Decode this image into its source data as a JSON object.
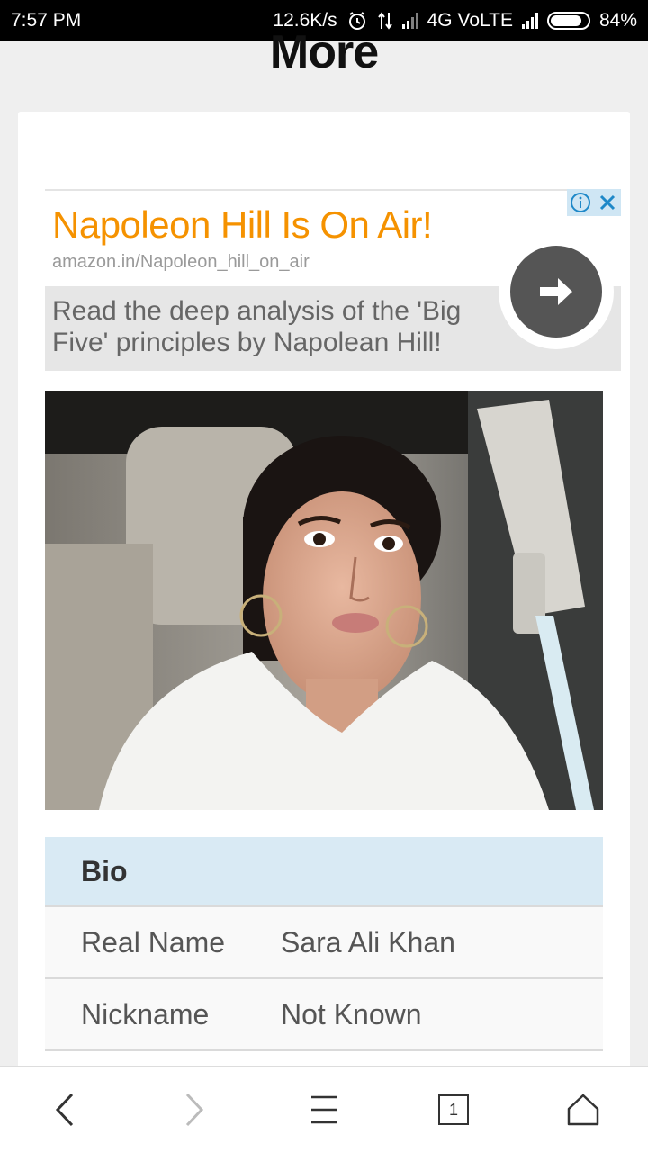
{
  "status_bar": {
    "time": "7:57 PM",
    "speed": "12.6K/s",
    "network": "4G VoLTE",
    "battery": "84%"
  },
  "page": {
    "heading_partial": "More"
  },
  "ad": {
    "title": "Napoleon Hill Is On Air!",
    "url": "amazon.in/Napoleon_hill_on_air",
    "description": "Read the deep analysis of the 'Big Five' principles by Napolean Hill!",
    "icons": [
      "info-icon",
      "close-icon",
      "arrow-right-icon"
    ],
    "colors": {
      "title": "#f59200",
      "choices_bg": "#cfe6f4"
    }
  },
  "photo": {
    "subject": "portrait-photo"
  },
  "bio": {
    "header": "Bio",
    "rows": [
      {
        "label": "Real Name",
        "value": "Sara Ali Khan"
      },
      {
        "label": "Nickname",
        "value": "Not Known"
      }
    ]
  },
  "nav": {
    "tab_count": "1",
    "icons": [
      "back-icon",
      "forward-icon",
      "menu-icon",
      "tabs-icon",
      "home-icon"
    ]
  }
}
